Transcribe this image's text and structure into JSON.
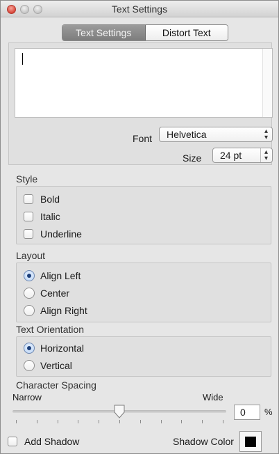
{
  "window": {
    "title": "Text Settings"
  },
  "tabs": [
    {
      "label": "Text Settings",
      "active": true
    },
    {
      "label": "Distort Text",
      "active": false
    }
  ],
  "text_box": {
    "value": ""
  },
  "font": {
    "label": "Font",
    "value": "Helvetica"
  },
  "size": {
    "label": "Size",
    "value": "24 pt"
  },
  "style": {
    "header": "Style",
    "options": [
      {
        "label": "Bold",
        "checked": false
      },
      {
        "label": "Italic",
        "checked": false
      },
      {
        "label": "Underline",
        "checked": false
      }
    ]
  },
  "layout": {
    "header": "Layout",
    "options": [
      {
        "label": "Align Left",
        "selected": true
      },
      {
        "label": "Center",
        "selected": false
      },
      {
        "label": "Align Right",
        "selected": false
      }
    ]
  },
  "orientation": {
    "header": "Text Orientation",
    "options": [
      {
        "label": "Horizontal",
        "selected": true
      },
      {
        "label": "Vertical",
        "selected": false
      }
    ]
  },
  "spacing": {
    "header": "Character Spacing",
    "min_label": "Narrow",
    "max_label": "Wide",
    "value": "0",
    "unit": "%",
    "slider_fraction": 0.5
  },
  "shadow": {
    "add_label": "Add Shadow",
    "checked": false,
    "color_label": "Shadow Color",
    "color": "#000000"
  }
}
